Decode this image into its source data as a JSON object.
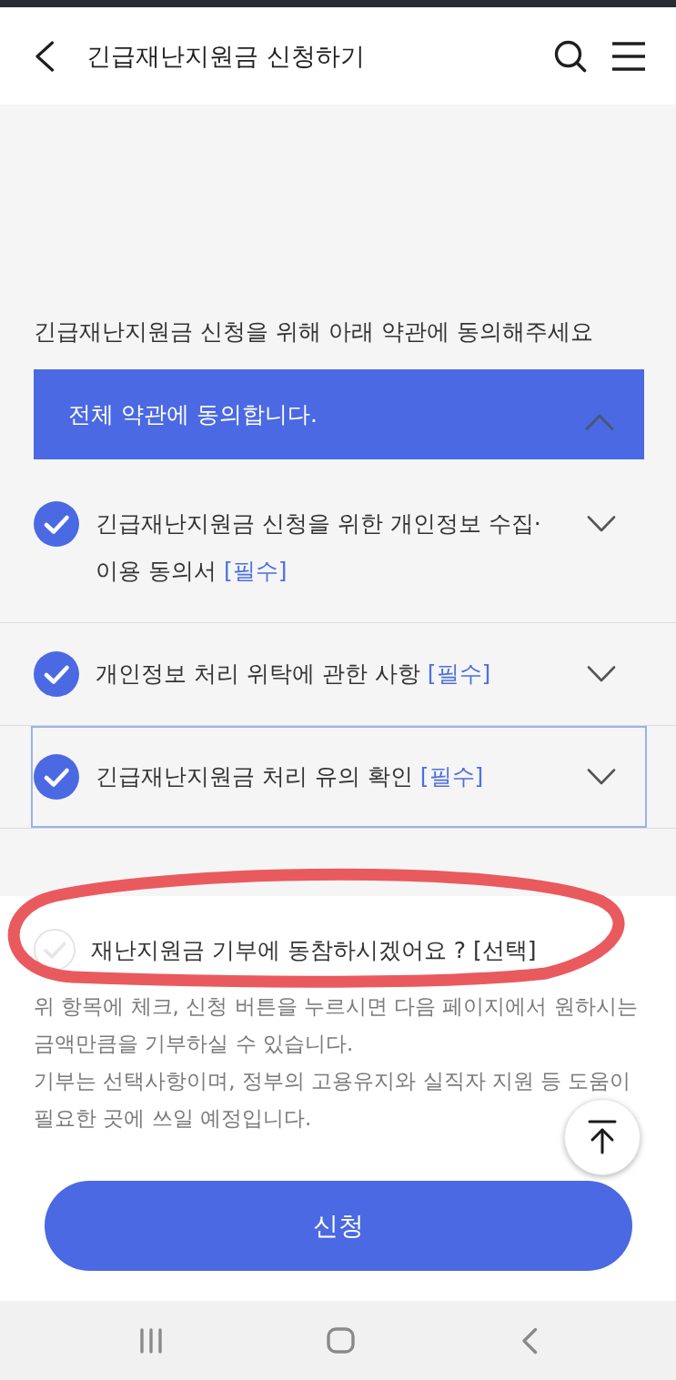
{
  "header": {
    "title": "긴급재난지원금 신청하기"
  },
  "instruction": "긴급재난지원금 신청을 위해 아래 약관에 동의해주세요",
  "all_agree": {
    "label": "전체 약관에 동의합니다.",
    "expanded": true
  },
  "items": [
    {
      "label": "긴급재난지원금 신청을 위한 개인정보 수집·이용 동의서",
      "tag": "[필수]",
      "checked": true,
      "expanded": false,
      "focused": false
    },
    {
      "label": "개인정보 처리 위탁에 관한 사항",
      "tag": "[필수]",
      "checked": true,
      "expanded": false,
      "focused": false
    },
    {
      "label": "긴급재난지원금 처리 유의 확인",
      "tag": "[필수]",
      "checked": true,
      "expanded": false,
      "focused": true
    }
  ],
  "donation": {
    "label": "재난지원금 기부에 동참하시겠어요 ? [선택]",
    "checked": false,
    "paragraphs": [
      "위 항목에 체크, 신청 버튼을 누르시면 다음 페이지에서 원하시는 금액만큼을 기부하실 수 있습니다.",
      "기부는 선택사항이며, 정부의 고용유지와 실직자 지원 등 도움이 필요한 곳에 쓰일 예정입니다."
    ]
  },
  "submit_button": "신청"
}
